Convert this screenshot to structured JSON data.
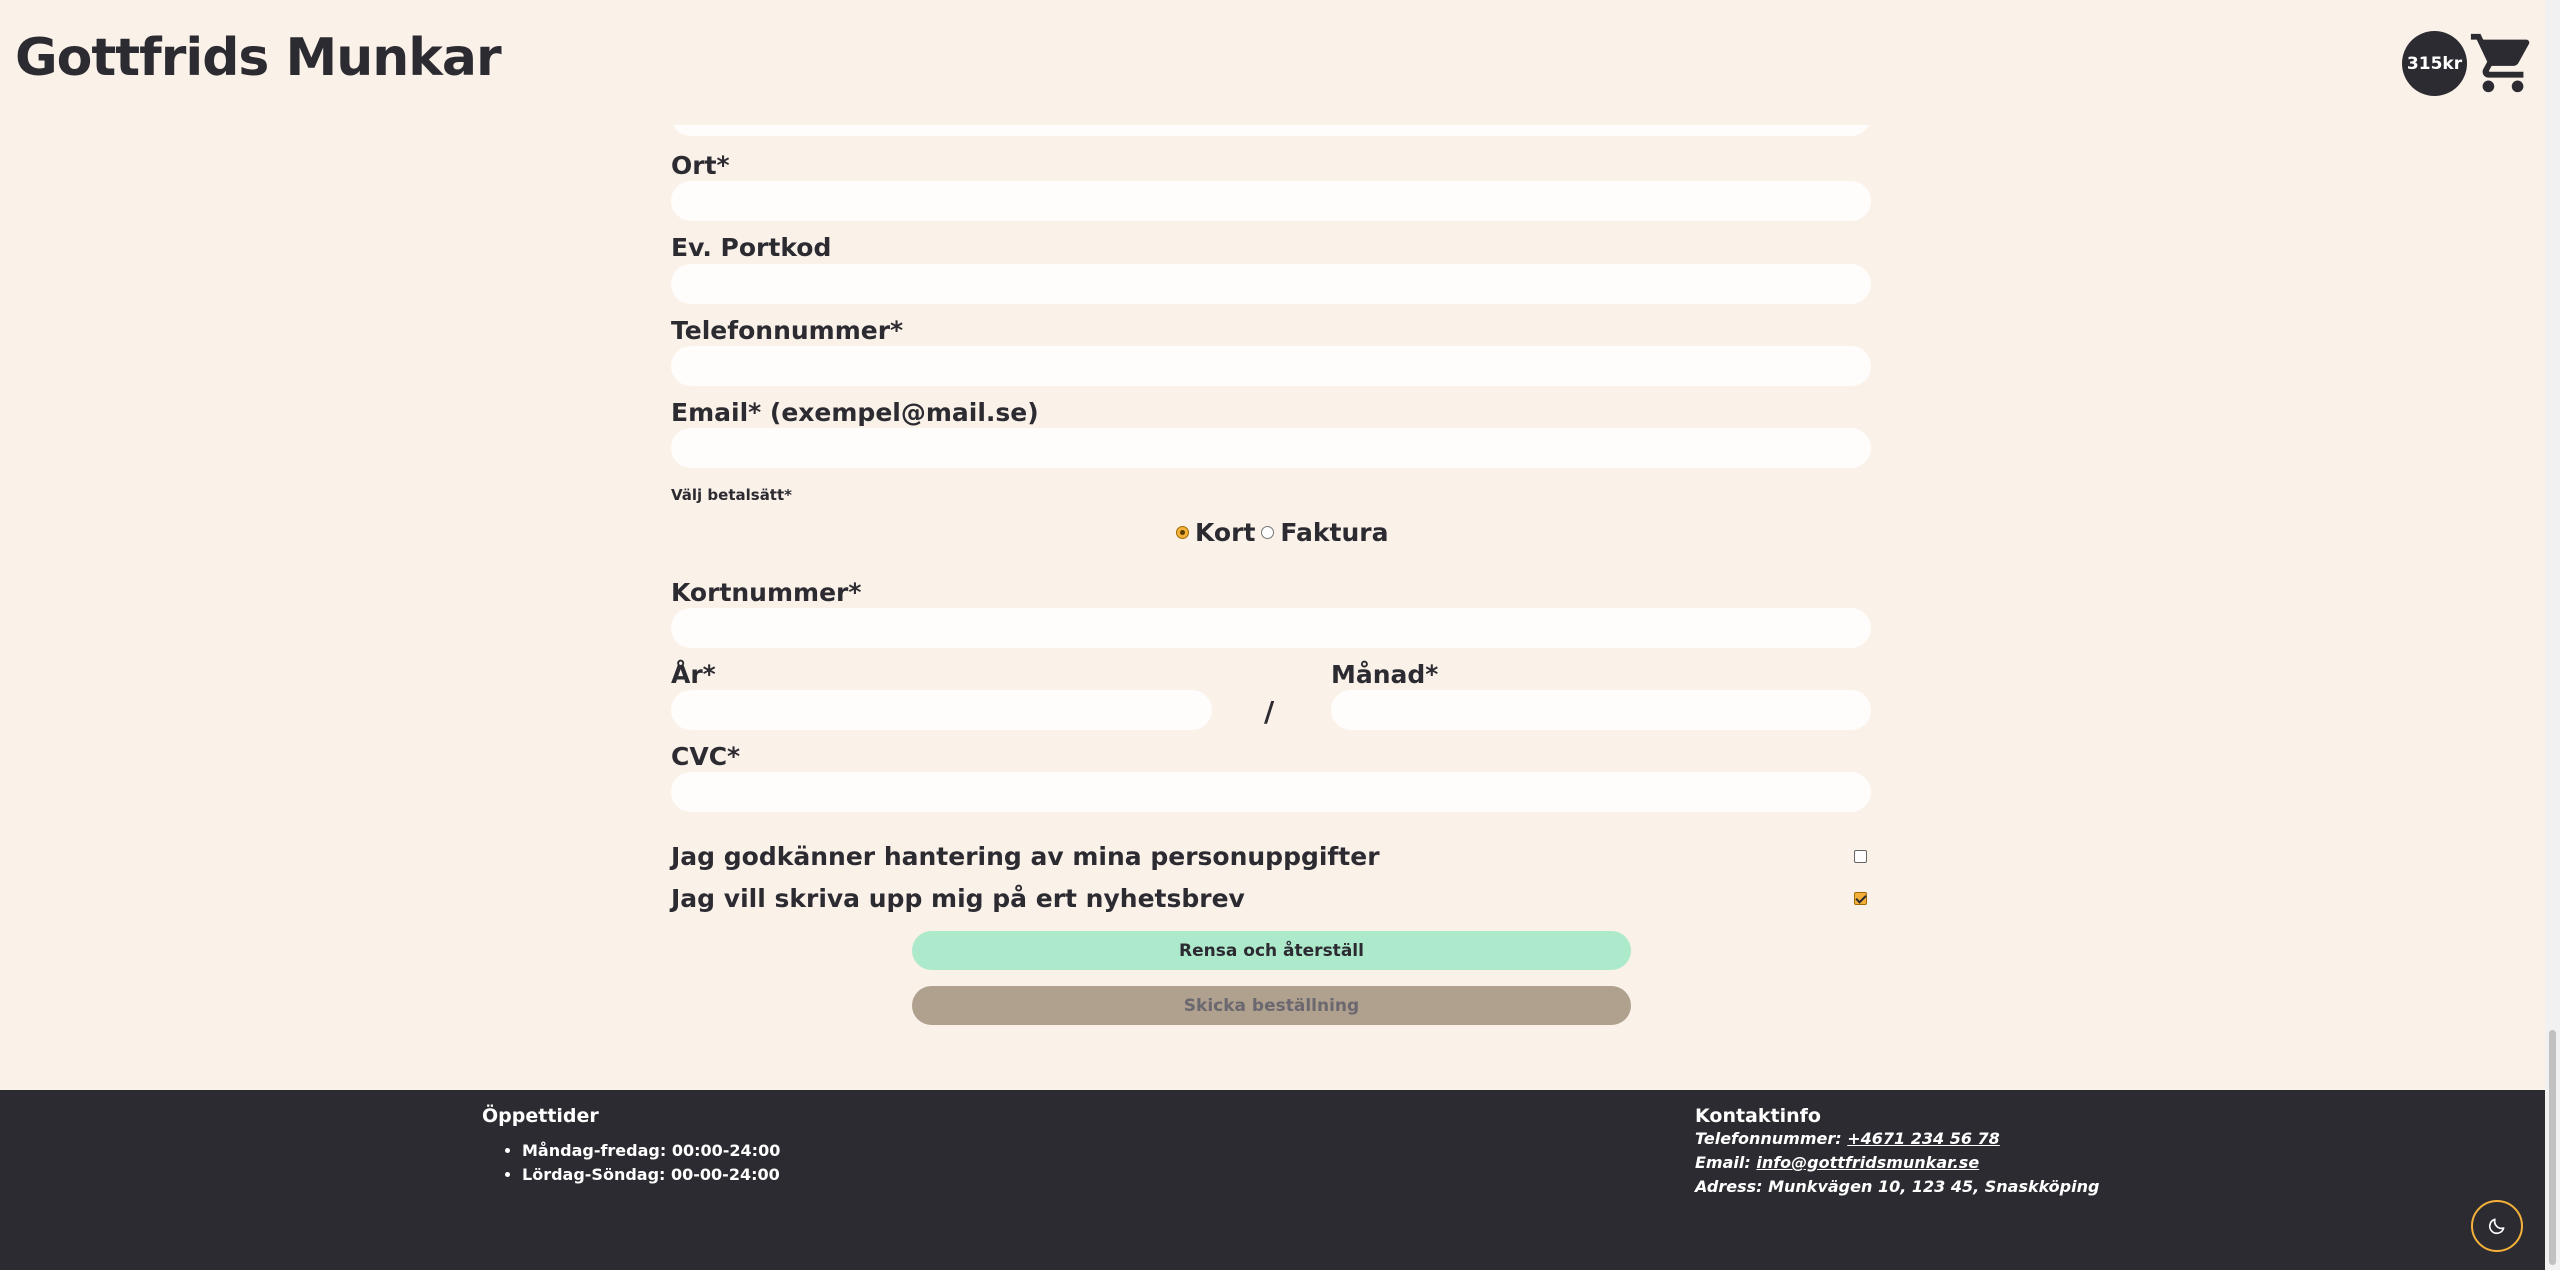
{
  "header": {
    "logo": "Gottfrids Munkar",
    "cart_total": "315kr",
    "cart_icon": "shopping-cart-icon"
  },
  "form": {
    "fields": [
      {
        "label": "Ort*",
        "value": ""
      },
      {
        "label": "Ev. Portkod",
        "value": ""
      },
      {
        "label": "Telefonnummer*",
        "value": ""
      },
      {
        "label": "Email* (exempel@mail.se)",
        "value": ""
      }
    ],
    "payment": {
      "label": "Välj betalsätt*",
      "options": [
        {
          "label": "Kort",
          "selected": true
        },
        {
          "label": "Faktura",
          "selected": false
        }
      ]
    },
    "card_number_label": "Kortnummer*",
    "year_label": "År*",
    "separator": "/",
    "month_label": "Månad*",
    "cvc_label": "CVC*",
    "consent_label": "Jag godkänner hantering av mina personuppgifter",
    "consent_checked": false,
    "newsletter_label": "Jag vill skriva upp mig på ert nyhetsbrev",
    "newsletter_checked": true,
    "reset_button": "Rensa och återställ",
    "submit_button": "Skicka beställning"
  },
  "footer": {
    "hours_title": "Öppettider",
    "hours": [
      "Måndag-fredag: 00:00-24:00",
      "Lördag-Söndag: 00-00-24:00"
    ],
    "contact_title": "Kontaktinfo",
    "phone_label": "Telefonnummer:",
    "phone": "+4671 234 56 78",
    "email_label": "Email:",
    "email": "info@gottfridsmunkar.se",
    "address": "Adress: Munkvägen 10, 123 45, Snaskköping"
  },
  "colors": {
    "background": "#faf1e9",
    "dark": "#2c2b31",
    "accent": "#f3b13a",
    "reset": "#ade9cb",
    "submit": "#b0a08e"
  },
  "theme_toggle_icon": "moon-icon"
}
